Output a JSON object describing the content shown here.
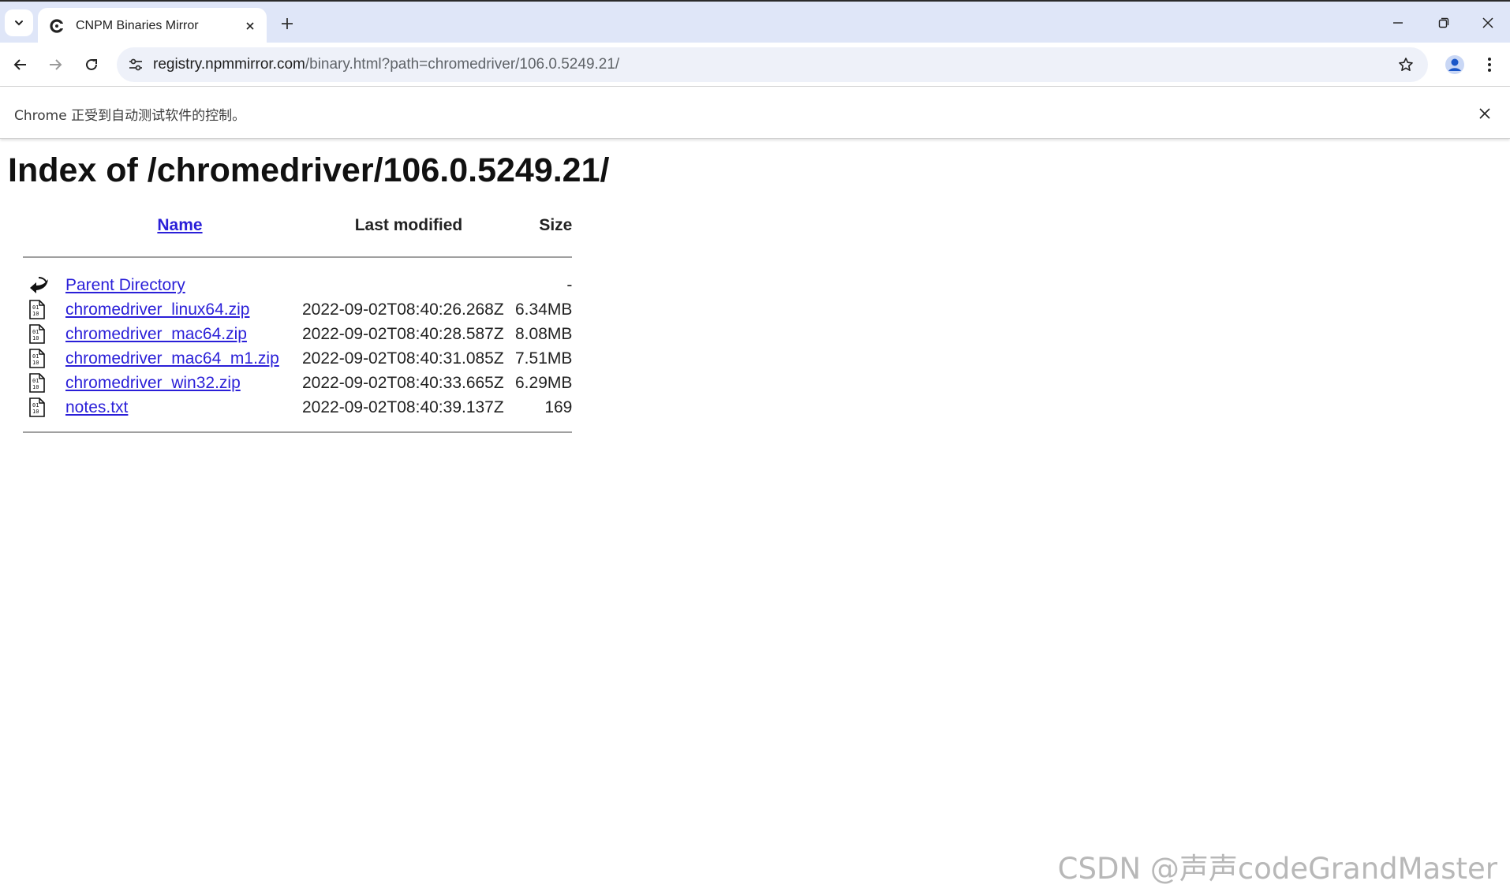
{
  "browser": {
    "tab_title": "CNPM Binaries Mirror",
    "url_host": "registry.npmmirror.com",
    "url_rest": "/binary.html?path=chromedriver/106.0.5249.21/",
    "infobar_text": "Chrome 正受到自动测试软件的控制。"
  },
  "page": {
    "title": "Index of /chromedriver/106.0.5249.21/",
    "columns": {
      "name": "Name",
      "modified": "Last modified",
      "size": "Size"
    },
    "rows": [
      {
        "name": "Parent Directory",
        "modified": "",
        "size": "-",
        "icon": "back-icon"
      },
      {
        "name": "chromedriver_linux64.zip",
        "modified": "2022-09-02T08:40:26.268Z",
        "size": "6.34MB",
        "icon": "binary-file-icon"
      },
      {
        "name": "chromedriver_mac64.zip",
        "modified": "2022-09-02T08:40:28.587Z",
        "size": "8.08MB",
        "icon": "binary-file-icon"
      },
      {
        "name": "chromedriver_mac64_m1.zip",
        "modified": "2022-09-02T08:40:31.085Z",
        "size": "7.51MB",
        "icon": "binary-file-icon"
      },
      {
        "name": "chromedriver_win32.zip",
        "modified": "2022-09-02T08:40:33.665Z",
        "size": "6.29MB",
        "icon": "binary-file-icon"
      },
      {
        "name": "notes.txt",
        "modified": "2022-09-02T08:40:39.137Z",
        "size": "169",
        "icon": "binary-file-icon"
      }
    ]
  },
  "watermark": "CSDN @声声codeGrandMaster",
  "colors": {
    "link": "#2a1fd8",
    "tabstrip": "#dfe6f8",
    "omnibox": "#eef1f9"
  }
}
